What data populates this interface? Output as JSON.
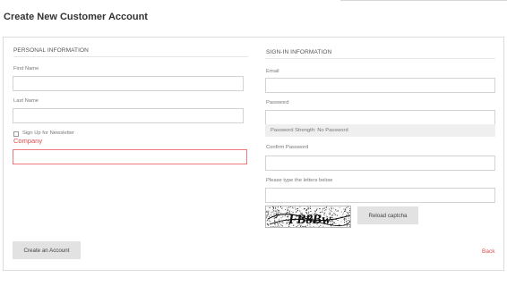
{
  "page": {
    "title": "Create New Customer Account"
  },
  "personal": {
    "heading": "PERSONAL INFORMATION",
    "first_name": {
      "label": "First Name",
      "value": ""
    },
    "last_name": {
      "label": "Last Name",
      "value": ""
    },
    "newsletter": {
      "label": "Sign Up for Newsletter",
      "checked": false
    },
    "company": {
      "label": "Company",
      "value": ""
    }
  },
  "signin": {
    "heading": "SIGN-IN INFORMATION",
    "email": {
      "label": "Email",
      "value": ""
    },
    "password": {
      "label": "Password",
      "value": ""
    },
    "strength_text": "Password Strength: No Password",
    "confirm_password": {
      "label": "Confirm Password",
      "value": ""
    },
    "captcha": {
      "label": "Please type the letters below",
      "value": "",
      "code": "FB8Bw"
    },
    "reload_label": "Reload captcha"
  },
  "actions": {
    "create_label": "Create an Account",
    "back_label": "Back"
  },
  "colors": {
    "error": "#e14b4b",
    "button": "#e2e2e2",
    "border": "#d3d3d3"
  }
}
